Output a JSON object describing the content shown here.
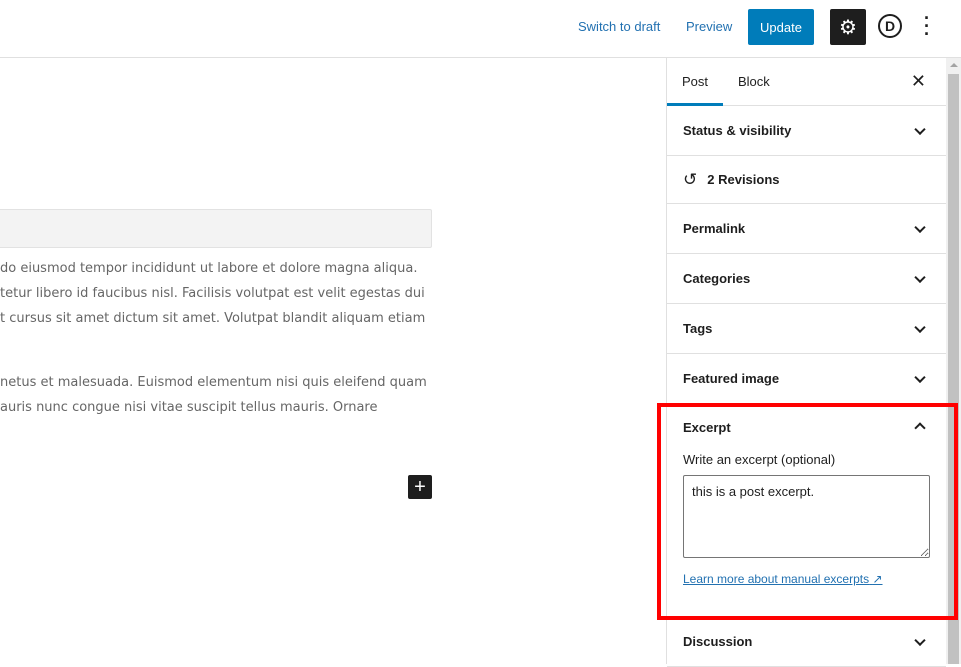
{
  "header": {
    "switch_to_draft": "Switch to draft",
    "preview": "Preview",
    "update": "Update",
    "settings_icon": "gear-icon",
    "plugin_logo": "D",
    "more_icon": "more-vertical-icon"
  },
  "editor": {
    "paragraphs": [
      [
        "do eiusmod tempor incididunt ut labore et dolore magna aliqua.",
        "tetur libero id faucibus nisl. Facilisis volutpat est velit egestas dui",
        "t cursus sit amet dictum sit amet. Volutpat blandit aliquam etiam"
      ],
      [
        "netus et malesuada. Euismod elementum nisi quis eleifend quam",
        "auris nunc congue nisi vitae suscipit tellus mauris. Ornare"
      ]
    ],
    "add_block": "+"
  },
  "sidebar": {
    "tabs": [
      "Post",
      "Block"
    ],
    "close": "✕",
    "sections": {
      "status": "Status & visibility",
      "revisions": "2 Revisions",
      "permalink": "Permalink",
      "categories": "Categories",
      "tags": "Tags",
      "featured_image": "Featured image",
      "discussion": "Discussion"
    },
    "excerpt": {
      "title": "Excerpt",
      "label": "Write an excerpt (optional)",
      "value": "this is a post excerpt.",
      "learn_more": "Learn more about manual excerpts",
      "external_icon": "↗"
    }
  },
  "colors": {
    "accent": "#007cba",
    "highlight": "#ff0000"
  }
}
